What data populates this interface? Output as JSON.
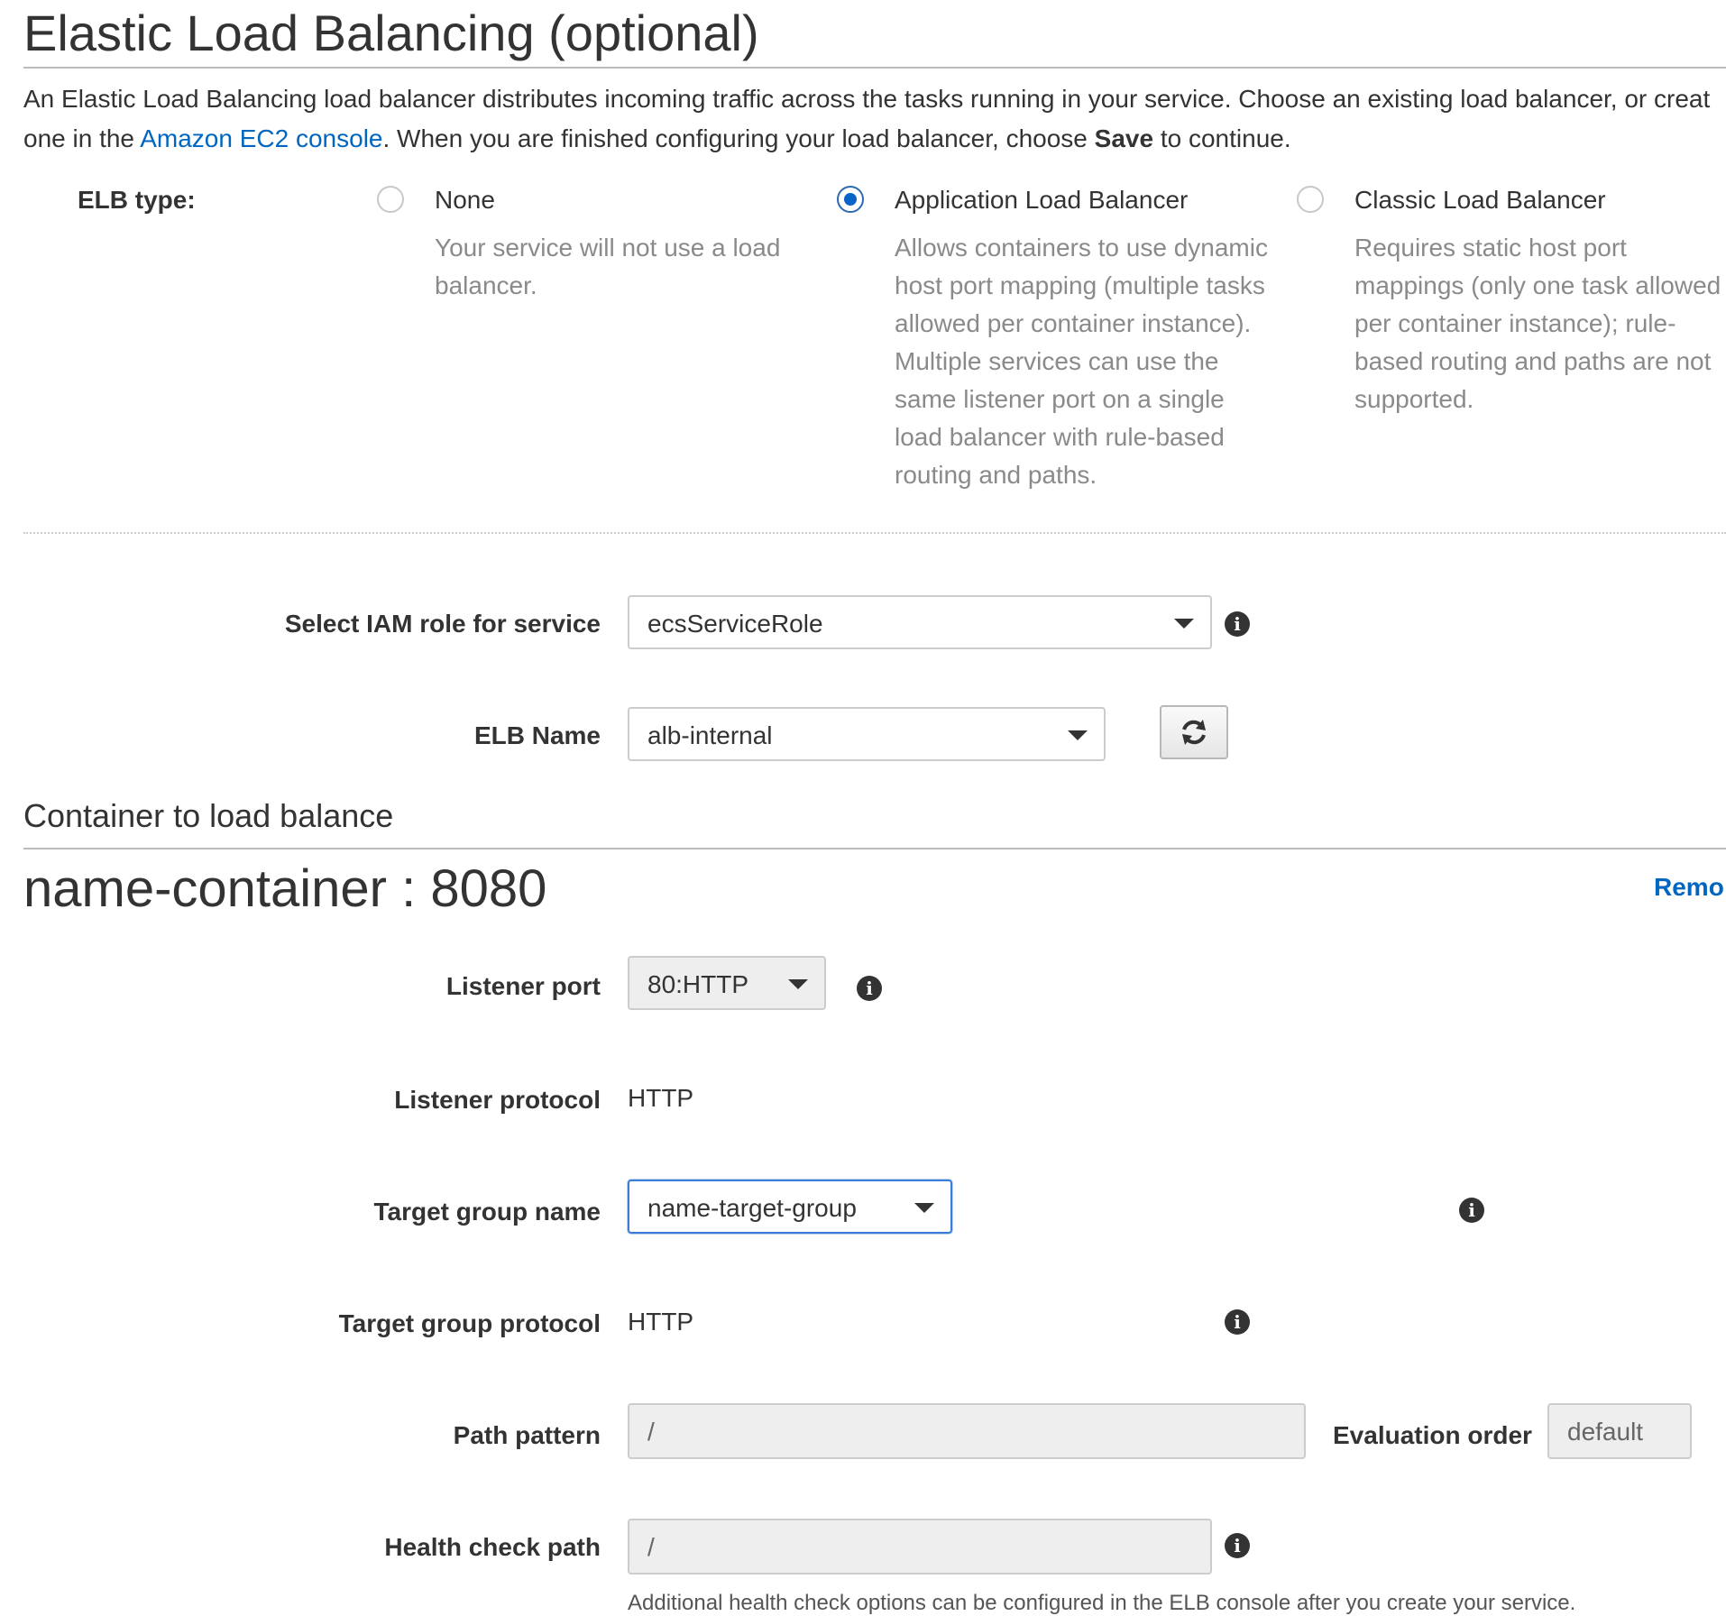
{
  "header": {
    "title": "Elastic Load Balancing (optional)",
    "intro_line1": "An Elastic Load Balancing load balancer distributes incoming traffic across the tasks running in your service. Choose an existing load balancer, or creat",
    "intro_line2_prefix": "one in the ",
    "intro_link": "Amazon EC2 console",
    "intro_line2_mid": ". When you are finished configuring your load balancer, choose ",
    "intro_bold": "Save",
    "intro_line2_suffix": " to continue."
  },
  "elb_type": {
    "label": "ELB type:",
    "selected": "Application Load Balancer",
    "options": [
      {
        "title": "None",
        "desc": [
          "Your service will not use a load",
          "balancer."
        ]
      },
      {
        "title": "Application Load Balancer",
        "desc": [
          "Allows containers to use dynamic",
          "host port mapping (multiple tasks",
          "allowed per container instance).",
          "Multiple services can use the",
          "same listener port on a single",
          "load balancer with rule-based",
          "routing and paths."
        ]
      },
      {
        "title": "Classic Load Balancer",
        "desc": [
          "Requires static host port",
          "mappings (only one task allowed",
          "per container instance); rule-",
          "based routing and paths are not",
          "supported."
        ]
      }
    ]
  },
  "iam_role": {
    "label": "Select IAM role for service",
    "value": "ecsServiceRole",
    "info_icon": "i"
  },
  "elb_name": {
    "label": "ELB Name",
    "value": "alb-internal",
    "refresh_icon": "⟳"
  },
  "container_section": {
    "title": "Container to load balance",
    "container": "name-container : 8080",
    "remove_label": "Remo"
  },
  "listener_port": {
    "label": "Listener port",
    "value": "80:HTTP",
    "info_icon": "i"
  },
  "listener_protocol": {
    "label": "Listener protocol",
    "value": "HTTP"
  },
  "target_group_name": {
    "label": "Target group name",
    "value": "name-target-group",
    "info_icon": "i"
  },
  "target_group_protocol": {
    "label": "Target group protocol",
    "value": "HTTP",
    "info_icon": "i"
  },
  "path_pattern": {
    "label": "Path pattern",
    "value": "/"
  },
  "evaluation_order": {
    "label": "Evaluation order",
    "value": "default"
  },
  "health_check": {
    "label": "Health check path",
    "value": "/",
    "info_icon": "i",
    "hint": "Additional health check options can be configured in the ELB console after you create your service."
  },
  "colors": {
    "link": "#0066c0",
    "radio_selected": "#0a63c9",
    "muted_text": "#8a8a8a"
  }
}
